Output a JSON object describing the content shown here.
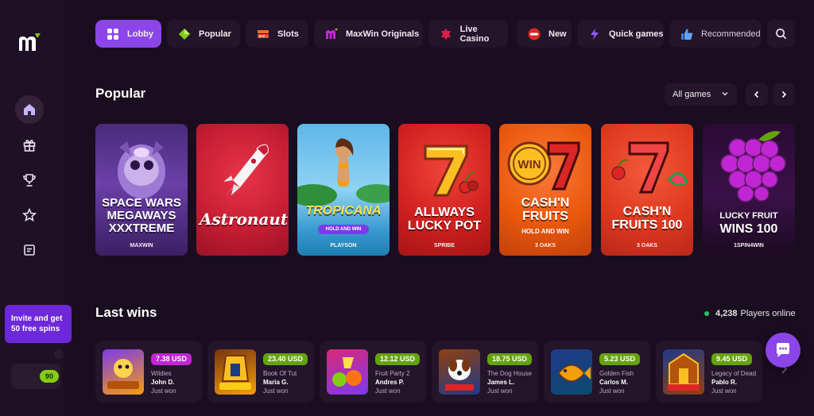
{
  "nav": {
    "items": [
      {
        "label": "Lobby",
        "icon": "grid-icon"
      },
      {
        "label": "Popular",
        "icon": "diamond-icon"
      },
      {
        "label": "Slots",
        "icon": "slots-icon"
      },
      {
        "label": "MaxWin Originals",
        "icon": "maxwin-logo-icon"
      },
      {
        "label": "Live Casino",
        "icon": "live-casino-icon"
      },
      {
        "label": "New",
        "icon": "new-badge-icon"
      },
      {
        "label": "Quick games",
        "icon": "lightning-icon"
      },
      {
        "label": "Recommended",
        "icon": "thumbs-up-icon"
      }
    ],
    "active": "Lobby"
  },
  "sidebar": {
    "icons": [
      "home-icon",
      "gift-icon",
      "trophy-icon",
      "star-icon",
      "news-icon"
    ],
    "invite": {
      "line1": "Invite and get",
      "line2": "50 free spins"
    },
    "points": "90"
  },
  "popular": {
    "title": "Popular",
    "filter": "All games",
    "games": [
      {
        "title": "SPACE WARS MEGAWAYS XXXTREME",
        "sub": "",
        "provider": "MAXWIN"
      },
      {
        "title": "Astronaut",
        "sub": "",
        "provider": ""
      },
      {
        "title": "TROPICANA",
        "sub": "HOLD AND WIN",
        "provider": "PLAYSON"
      },
      {
        "title": "ALLWAYS LUCKY POT",
        "sub": "",
        "provider": "SPRIBE"
      },
      {
        "title": "CASH'N FRUITS",
        "sub": "HOLD AND WIN",
        "provider": "3 OAKS"
      },
      {
        "title": "CASH'N FRUITS 100",
        "sub": "",
        "provider": "3 OAKS"
      },
      {
        "title": "LUCKY FRUIT",
        "sub": "WINS 100",
        "provider": "1SPIN4WIN"
      }
    ]
  },
  "last_wins": {
    "title": "Last wins",
    "online_count": "4,238",
    "online_label": "Players online",
    "entries": [
      {
        "amount": "7.38 USD",
        "game": "Wildies",
        "player": "John D.",
        "when": "Just won",
        "badge_color": "#c026d3"
      },
      {
        "amount": "23.40 USD",
        "game": "Book Of Tut",
        "player": "Maria G.",
        "when": "Just won",
        "badge_color": "#65a30d"
      },
      {
        "amount": "12.12 USD",
        "game": "Fruit Party 2",
        "player": "Andres P.",
        "when": "Just won",
        "badge_color": "#65a30d"
      },
      {
        "amount": "18.75 USD",
        "game": "The Dog House",
        "player": "James L.",
        "when": "Just won",
        "badge_color": "#65a30d"
      },
      {
        "amount": "5.23 USD",
        "game": "Golden Fish",
        "player": "Carlos M.",
        "when": "Just won",
        "badge_color": "#65a30d"
      },
      {
        "amount": "9.45 USD",
        "game": "Legacy of Dead",
        "player": "Pablo R.",
        "when": "Just won",
        "badge_color": "#65a30d"
      }
    ]
  },
  "colors": {
    "accent": "#8b45e8",
    "background": "#1a0d20",
    "panel": "#24152a",
    "online": "#22c55e"
  }
}
